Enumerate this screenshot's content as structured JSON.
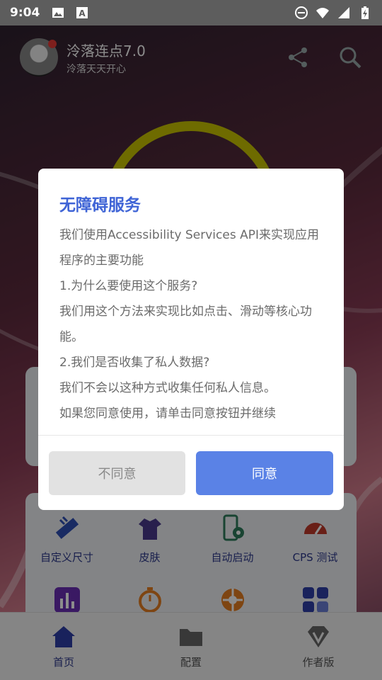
{
  "status_bar": {
    "time": "9:04",
    "icons": [
      "image-icon",
      "font-icon",
      "do-not-disturb-icon",
      "wifi-icon",
      "signal-icon",
      "battery-charging-icon"
    ]
  },
  "app": {
    "title": "泠落连点7.0",
    "subtitle": "泠落天天开心",
    "header_icons": [
      "share-icon",
      "search-icon"
    ]
  },
  "dialog": {
    "title": "无障碍服务",
    "body": [
      "我们使用Accessibility Services API来实现应用程序的主要功能",
      "1.为什么要使用这个服务?",
      "我们用这个方法来实现比如点击、滑动等核心功能。",
      "2.我们是否收集了私人数据?",
      "我们不会以这种方式收集任何私人信息。",
      "如果您同意使用，请单击同意按钮并继续"
    ],
    "disagree_label": "不同意",
    "agree_label": "同意",
    "accent_color": "#3f64d6",
    "agree_color": "#5a82e6"
  },
  "features": [
    {
      "label": "自定义尺寸",
      "icon": "ruler-icon"
    },
    {
      "label": "皮肤",
      "icon": "shirt-icon"
    },
    {
      "label": "自动启动",
      "icon": "phone-auto-icon"
    },
    {
      "label": "CPS 测试",
      "icon": "speedometer-icon"
    },
    {
      "label": "",
      "icon": "bar-chart-icon"
    },
    {
      "label": "",
      "icon": "stopwatch-icon"
    },
    {
      "label": "",
      "icon": "aperture-icon"
    },
    {
      "label": "",
      "icon": "grid-apps-icon"
    }
  ],
  "bottom_nav": [
    {
      "label": "首页",
      "icon": "home-icon",
      "active": true
    },
    {
      "label": "配置",
      "icon": "folder-icon",
      "active": false
    },
    {
      "label": "作者版",
      "icon": "diamond-v-icon",
      "active": false
    }
  ]
}
